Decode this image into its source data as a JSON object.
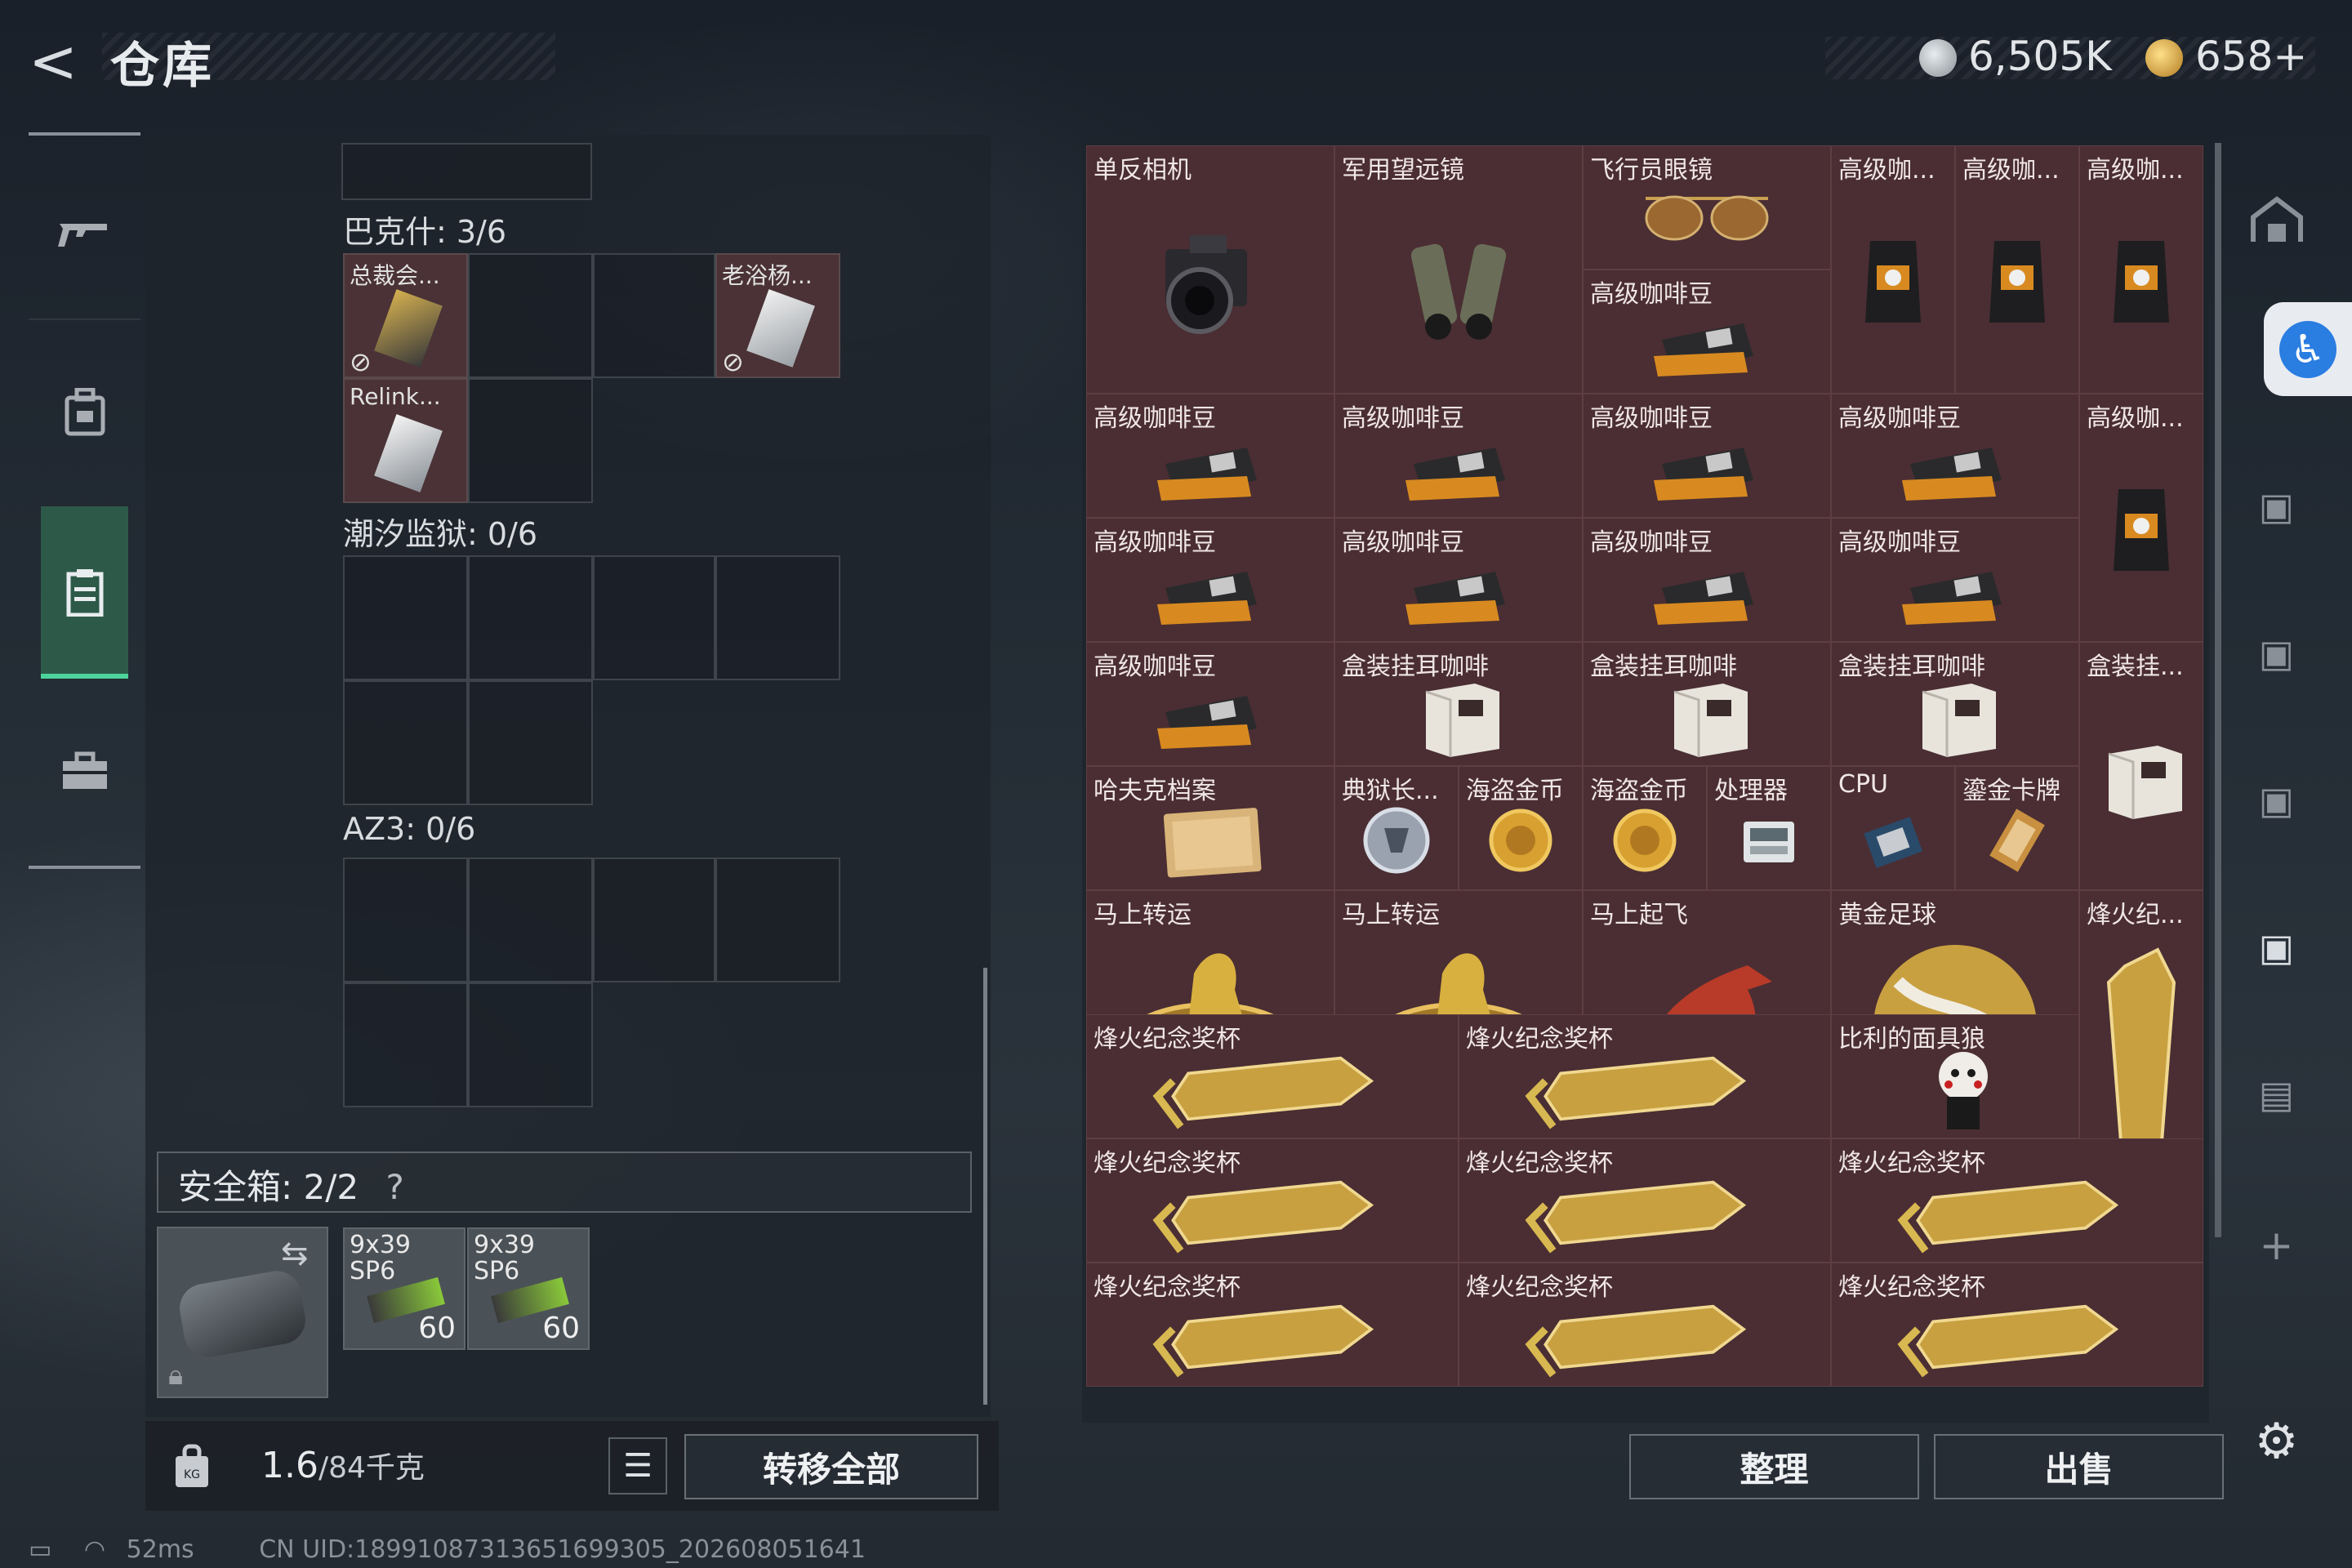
{
  "header": {
    "back": "<",
    "title": "仓库",
    "currency1": "6,505K",
    "currency2": "658+",
    "coin1_color": "#b8bec4",
    "coin2_color": "#d8a840"
  },
  "left": {
    "groups": [
      {
        "name": "巴克什: 3/6",
        "items": [
          "总裁会...",
          "老浴杨...",
          "Relink..."
        ]
      },
      {
        "name": "潮汐监狱: 0/6"
      },
      {
        "name": "AZ3: 0/6"
      }
    ],
    "safe_box": {
      "label": "安全箱: 2/2",
      "help": "?"
    },
    "ammo": [
      {
        "name": "9x39 SP6",
        "count": "60"
      },
      {
        "name": "9x39 SP6",
        "count": "60"
      }
    ],
    "weight_value": "1.6",
    "weight_max": "/84千克",
    "transfer_all": "转移全部"
  },
  "grid": {
    "items": [
      "单反相机",
      "军用望远镜",
      "飞行员眼镜",
      "高级咖...",
      "高级咖...",
      "高级咖...",
      "高级咖啡豆",
      "高级咖啡豆",
      "高级咖啡豆",
      "高级咖啡豆",
      "高级咖啡豆",
      "高级咖...",
      "高级咖啡豆",
      "高级咖啡豆",
      "高级咖啡豆",
      "高级咖啡豆",
      "高级咖啡豆",
      "盒装挂耳咖啡",
      "盒装挂耳咖啡",
      "盒装挂耳咖啡",
      "盒装挂...",
      "哈夫克档案",
      "典狱长...",
      "海盗金币",
      "海盗金币",
      "处理器",
      "CPU",
      "鎏金卡牌",
      "马上转运",
      "马上转运",
      "马上起飞",
      "黄金足球",
      "烽火纪...",
      "烽火纪念奖杯",
      "烽火纪念奖杯",
      "比利的面具狼",
      "烽火纪念奖杯",
      "烽火纪念奖杯",
      "烽火纪念奖杯",
      "烽火纪念奖杯",
      "烽火纪念奖杯",
      "烽火纪念奖杯"
    ],
    "sort": "整理",
    "sell": "出售"
  },
  "status": {
    "ping": "52ms",
    "uid": "CN UID:18991087313651699305_202608051641"
  }
}
